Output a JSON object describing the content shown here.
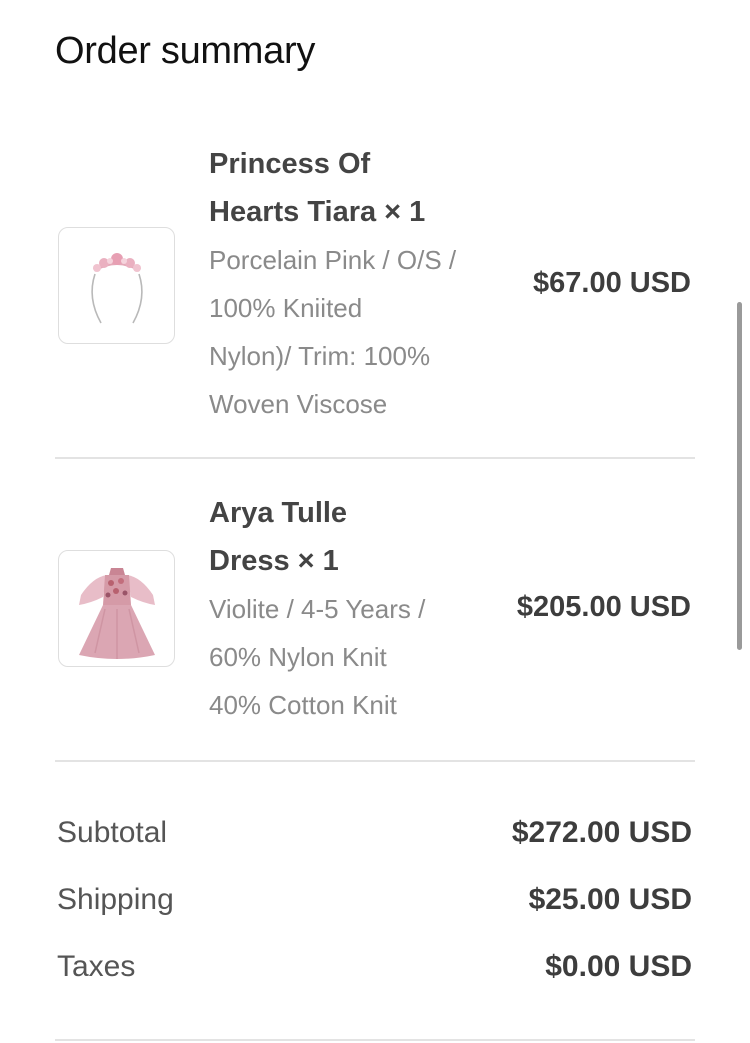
{
  "header": {
    "title": "Order summary"
  },
  "items": [
    {
      "name_line1": "Princess Of",
      "name_line2": "Hearts Tiara × 1",
      "desc_lines": [
        "Porcelain Pink / O/S /",
        "100% Kniited",
        "Nylon)/ Trim: 100%",
        "Woven Viscose"
      ],
      "price": "$67.00 USD",
      "thumbnail_icon": "tiara-image"
    },
    {
      "name_line1": "Arya Tulle",
      "name_line2": "Dress × 1",
      "desc_lines": [
        "Violite / 4-5 Years /",
        "60% Nylon Knit",
        "40% Cotton Knit"
      ],
      "price": "$205.00 USD",
      "thumbnail_icon": "dress-image"
    }
  ],
  "totals": {
    "subtotal_label": "Subtotal",
    "subtotal_value": "$272.00 USD",
    "shipping_label": "Shipping",
    "shipping_value": "$25.00 USD",
    "taxes_label": "Taxes",
    "taxes_value": "$0.00 USD"
  },
  "colors": {
    "text_primary": "#444444",
    "text_secondary": "#8a8a8a",
    "divider": "#e3e3e3",
    "thumbnail_border": "#dedede"
  }
}
